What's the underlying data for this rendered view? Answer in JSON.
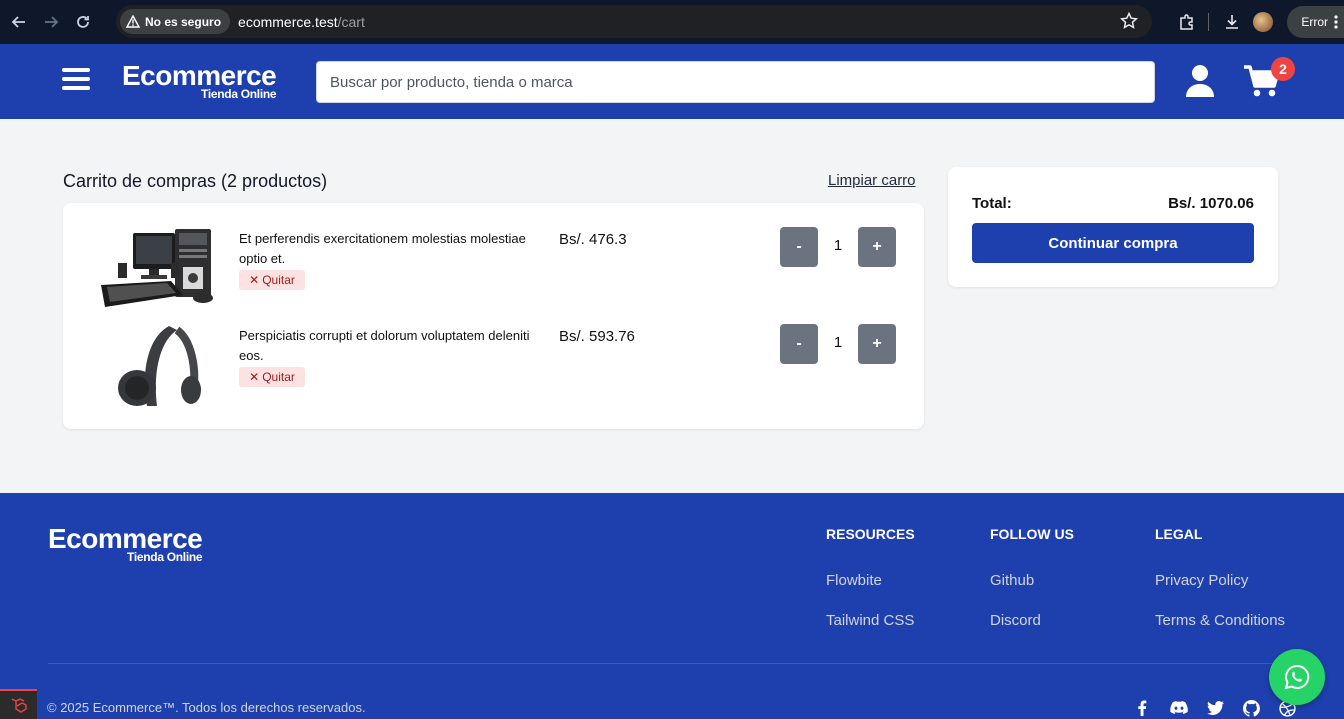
{
  "browser": {
    "security_label": "No es seguro",
    "url_host": "ecommerce.test",
    "url_path": "/cart",
    "error_label": "Error"
  },
  "header": {
    "logo_name": "Ecommerce",
    "logo_sub": "Tienda Online",
    "search_placeholder": "Buscar por producto, tienda o marca",
    "cart_count": "2"
  },
  "cart": {
    "title": "Carrito de compras (2 productos)",
    "clear_label": "Limpiar carro",
    "remove_label": "Quitar",
    "items": [
      {
        "name": "Et perferendis exercitationem molestias molestiae optio et.",
        "price": "Bs/. 476.3",
        "qty": "1"
      },
      {
        "name": "Perspiciatis corrupti et dolorum voluptatem deleniti eos.",
        "price": "Bs/. 593.76",
        "qty": "1"
      }
    ],
    "minus_label": "-",
    "plus_label": "+"
  },
  "summary": {
    "total_label": "Total:",
    "total_value": "Bs/. 1070.06",
    "checkout_label": "Continuar compra"
  },
  "footer": {
    "logo_name": "Ecommerce",
    "logo_sub": "Tienda Online",
    "columns": [
      {
        "title": "RESOURCES",
        "links": [
          "Flowbite",
          "Tailwind CSS"
        ]
      },
      {
        "title": "FOLLOW US",
        "links": [
          "Github",
          "Discord"
        ]
      },
      {
        "title": "LEGAL",
        "links": [
          "Privacy Policy",
          "Terms & Conditions"
        ]
      }
    ],
    "copyright": "© 2025 Ecommerce™. Todos los derechos reservados.",
    "social_icons": [
      "facebook-icon",
      "discord-icon",
      "twitter-icon",
      "github-icon",
      "dribbble-icon"
    ]
  },
  "colors": {
    "primary": "#1e40af",
    "badge": "#ef4444",
    "whatsapp": "#25d366"
  }
}
